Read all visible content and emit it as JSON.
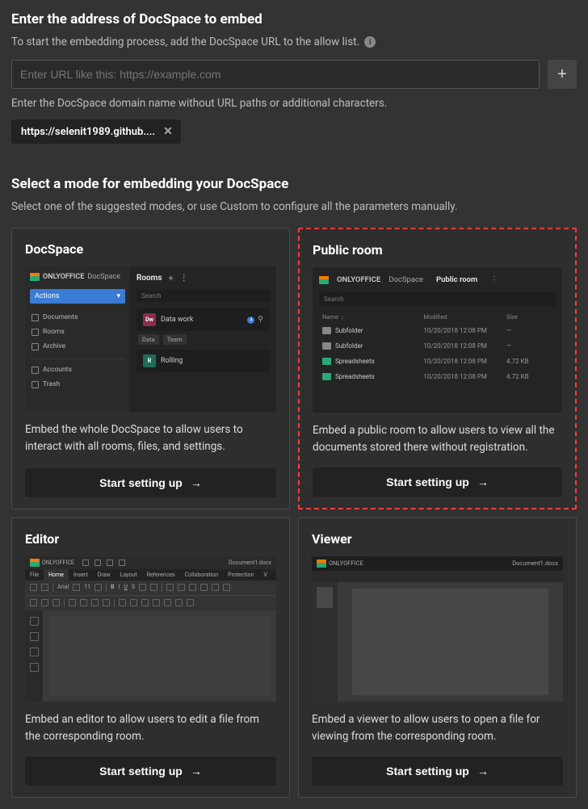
{
  "section1": {
    "title": "Enter the address of DocSpace to embed",
    "subtitle": "To start the embedding process, add the DocSpace URL to the allow list.",
    "url_placeholder": "Enter URL like this: https://example.com",
    "helper": "Enter the DocSpace domain name without URL paths or additional characters.",
    "chip": "https://selenit1989.github...."
  },
  "section2": {
    "title": "Select a mode for embedding your DocSpace",
    "subtitle": "Select one of the suggested modes, or use Custom to configure all the parameters manually."
  },
  "setup_label": "Start setting up",
  "cards": {
    "docspace": {
      "title": "DocSpace",
      "desc": "Embed the whole DocSpace to allow users to interact with all rooms, files, and settings.",
      "logo_text": "ONLYOFFICE",
      "logo_sub": "DocSpace",
      "actions": "Actions",
      "rooms_header": "Rooms",
      "search": "Search",
      "nav": [
        "Documents",
        "Rooms",
        "Archive",
        "Accounts",
        "Trash"
      ],
      "room1": "Data work",
      "room1_badge": "Dw",
      "tags": [
        "Data",
        "Team"
      ],
      "room2": "Rolling",
      "room2_badge": "R"
    },
    "public": {
      "title": "Public room",
      "desc": "Embed a public room to allow users to view all the documents stored there without registration.",
      "logo_text": "ONLYOFFICE",
      "logo_sub": "DocSpace",
      "room_name": "Public room",
      "search": "Search",
      "cols": [
        "Name",
        "Modified",
        "Size"
      ],
      "rows": [
        {
          "icon": "folder",
          "name": "Subfolder",
          "mod": "10/20/2018 12:08 PM",
          "size": "—"
        },
        {
          "icon": "folder",
          "name": "Subfolder",
          "mod": "10/20/2018 12:08 PM",
          "size": "—"
        },
        {
          "icon": "sheet",
          "name": "Spreadsheets",
          "mod": "10/20/2018 12:08 PM",
          "size": "4.72 KB"
        },
        {
          "icon": "sheet",
          "name": "Spreadsheets",
          "mod": "10/20/2018 12:08 PM",
          "size": "4.72 KB"
        }
      ]
    },
    "editor": {
      "title": "Editor",
      "desc": "Embed an editor to allow users to edit a file from the corresponding room.",
      "brand": "ONLYOFFICE",
      "doc": "Document1.docx",
      "tabs": [
        "File",
        "Home",
        "Insert",
        "Draw",
        "Layout",
        "References",
        "Collaboration",
        "Protection",
        "V"
      ],
      "font": "Arial"
    },
    "viewer": {
      "title": "Viewer",
      "desc": "Embed a viewer to allow users to open a file for viewing from the corresponding room.",
      "brand": "ONLYOFFICE",
      "doc": "Document1.docx"
    }
  }
}
